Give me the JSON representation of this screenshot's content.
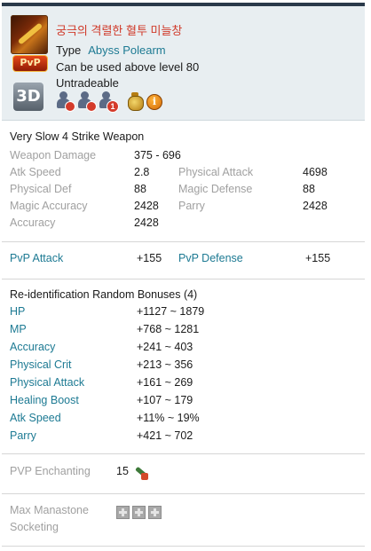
{
  "item": {
    "name": "궁극의 격렬한 혈투 미늘창",
    "type_label": "Type",
    "type_value": "Abyss Polearm",
    "level_text": "Can be used above level 80",
    "trade_text": "Untradeable",
    "pvp_badge": "PvP",
    "badge_3d": "3D",
    "restriction_number": "1",
    "info_glyph": "i"
  },
  "description": "Very Slow 4 Strike Weapon",
  "base_stats": {
    "weapon_damage": {
      "label": "Weapon Damage",
      "value": "375 - 696"
    },
    "left": [
      {
        "label": "Atk Speed",
        "value": "2.8"
      },
      {
        "label": "Physical Def",
        "value": "88"
      },
      {
        "label": "Magic Accuracy",
        "value": "2428"
      },
      {
        "label": "Accuracy",
        "value": "2428"
      }
    ],
    "right": [
      {
        "label": "Physical Attack",
        "value": "4698"
      },
      {
        "label": "Magic Defense",
        "value": "88"
      },
      {
        "label": "Parry",
        "value": "2428"
      }
    ]
  },
  "pvp_stats": [
    {
      "label": "PvP Attack",
      "value": "+155"
    },
    {
      "label": "PvP Defense",
      "value": "+155"
    }
  ],
  "random_bonuses": {
    "title": "Re-identification Random Bonuses (4)",
    "rows": [
      {
        "label": "HP",
        "value": "+1127 ~ 1879"
      },
      {
        "label": "MP",
        "value": "+768 ~ 1281"
      },
      {
        "label": "Accuracy",
        "value": "+241 ~ 403"
      },
      {
        "label": "Physical Crit",
        "value": "+213 ~ 356"
      },
      {
        "label": "Physical Attack",
        "value": "+161 ~ 269"
      },
      {
        "label": "Healing Boost",
        "value": "+107 ~ 179"
      },
      {
        "label": "Atk Speed",
        "value": "+11% ~ 19%"
      },
      {
        "label": "Parry",
        "value": "+421 ~ 702"
      }
    ]
  },
  "enchanting": {
    "label": "PVP Enchanting",
    "value": "15"
  },
  "manastone": {
    "label_line1": "Max Manastone",
    "label_line2": "Socketing",
    "slots": 3
  },
  "colors": {
    "name_red": "#d03a2a",
    "teal": "#1d7a93",
    "muted": "#a0a0a0",
    "header_bg": "#e8eef1"
  },
  "icons": [
    "polearm-item-icon",
    "pvp-badge-icon",
    "3d-view-icon",
    "no-trade-icon",
    "no-warehouse-icon",
    "restriction-count-icon",
    "money-bag-icon",
    "info-icon",
    "enchant-stone-icon",
    "manastone-slot-icon"
  ]
}
